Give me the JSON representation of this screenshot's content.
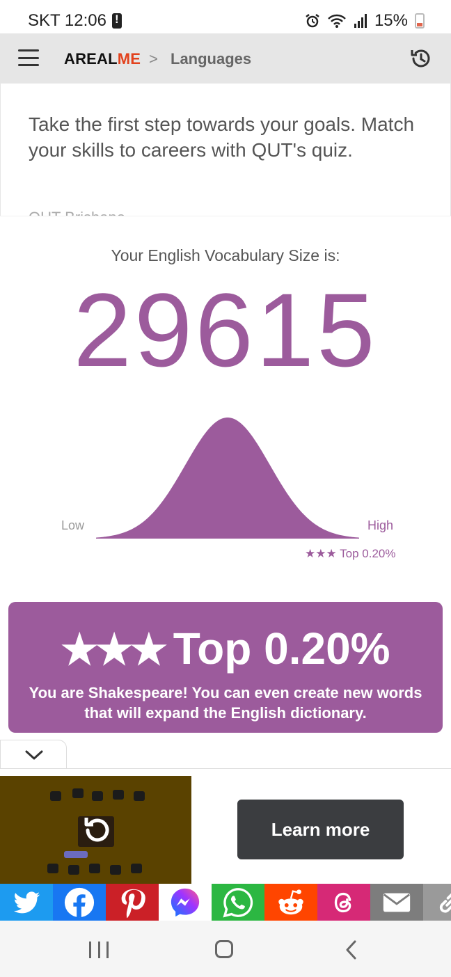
{
  "status_bar": {
    "carrier_time": "SKT 12:06",
    "battery": "15%",
    "icons": [
      "alert-icon",
      "alarm-icon",
      "wifi-icon",
      "signal-icon",
      "battery-icon"
    ]
  },
  "header": {
    "brand_part1": "AREAL",
    "brand_part2": "ME",
    "separator": ">",
    "breadcrumb": "Languages",
    "brand_colors": {
      "dark": "#111111",
      "accent": "#e2421d"
    }
  },
  "ad_teaser": {
    "text": "Take the first step towards your goals. Match your skills to careers with QUT's quiz.",
    "source": "QUT Brisbane"
  },
  "result": {
    "label": "Your English Vocabulary Size is:",
    "value": "29615",
    "accent_color": "#9c5b9c"
  },
  "chart_data": {
    "type": "area",
    "xlabel": "",
    "ylabel": "",
    "labels": {
      "low": "Low",
      "high": "High"
    },
    "marker": "★★★ Top 0.20%",
    "percentile_position": 0.998
  },
  "rank": {
    "stars": "★★★",
    "title": "Top 0.20%",
    "description": "You are Shakespeare! You can even create new words that will expand the English dictionary."
  },
  "ad_bar": {
    "cta": "Learn more"
  },
  "share_buttons": [
    {
      "name": "twitter-share-button",
      "icon": "twitter-icon",
      "color": "#1d9bf0"
    },
    {
      "name": "facebook-share-button",
      "icon": "facebook-icon",
      "color": "#1877f2"
    },
    {
      "name": "pinterest-share-button",
      "icon": "pinterest-icon",
      "color": "#cb2027"
    },
    {
      "name": "messenger-share-button",
      "icon": "messenger-icon",
      "color": "#ffffff"
    },
    {
      "name": "whatsapp-share-button",
      "icon": "whatsapp-icon",
      "color": "#2cb742"
    },
    {
      "name": "reddit-share-button",
      "icon": "reddit-icon",
      "color": "#ff4500"
    },
    {
      "name": "threads-share-button",
      "icon": "threads-icon",
      "color": "#d62976"
    },
    {
      "name": "email-share-button",
      "icon": "mail-icon",
      "color": "#7d7d7d"
    },
    {
      "name": "copy-link-button",
      "icon": "link-icon",
      "color": "#9a9a9a"
    }
  ]
}
